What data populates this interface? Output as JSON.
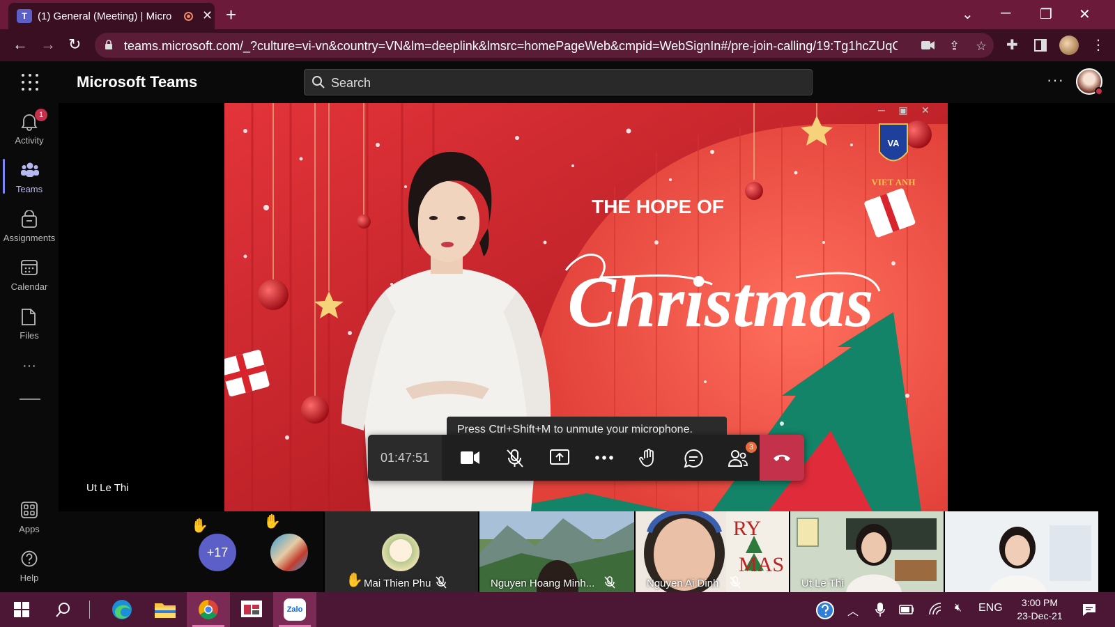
{
  "browser": {
    "tab_title": "(1) General (Meeting) | Micro",
    "tab_icon_letter": "T",
    "url": "teams.microsoft.com/_?culture=vi-vn&country=VN&lm=deeplink&lmsrc=homePageWeb&cmpid=WebSignIn#/pre-join-calling/19:Tg1hcZUqC..."
  },
  "teams": {
    "title": "Microsoft Teams",
    "search_placeholder": "Search"
  },
  "rail": {
    "activity": {
      "label": "Activity",
      "badge": "1"
    },
    "teams": {
      "label": "Teams"
    },
    "assignments": {
      "label": "Assignments"
    },
    "calendar": {
      "label": "Calendar"
    },
    "files": {
      "label": "Files"
    },
    "apps": {
      "label": "Apps"
    },
    "help": {
      "label": "Help"
    }
  },
  "meeting": {
    "stage_name": "Ut Le Thi",
    "toast": "Press Ctrl+Shift+M to unmute your microphone.",
    "timer": "01:47:51",
    "people_badge": "3",
    "video_text": {
      "line1": "THE HOPE OF",
      "line2": "Christmas",
      "logo_text": "VIET ANH",
      "logo_initials": "VA"
    },
    "overflow_count": "+17",
    "participants": [
      {
        "name": "Mai Thien Phu"
      },
      {
        "name": "Nguyen Hoang Minh..."
      },
      {
        "name": "Nguyen Ai Dinh"
      },
      {
        "name": "Ut Le Thi"
      }
    ],
    "bg_card_text": {
      "a": "RY",
      "b": "MAS"
    }
  },
  "taskbar": {
    "lang": "ENG",
    "time": "3:00 PM",
    "date": "23-Dec-21",
    "zalo_label": "Zalo"
  },
  "colors": {
    "browser_frame": "#6b1a3a",
    "tab_active": "#3a0f21",
    "teams_accent": "#7f85f5",
    "hangup": "#c4314b",
    "taskbar": "#4b1735"
  }
}
